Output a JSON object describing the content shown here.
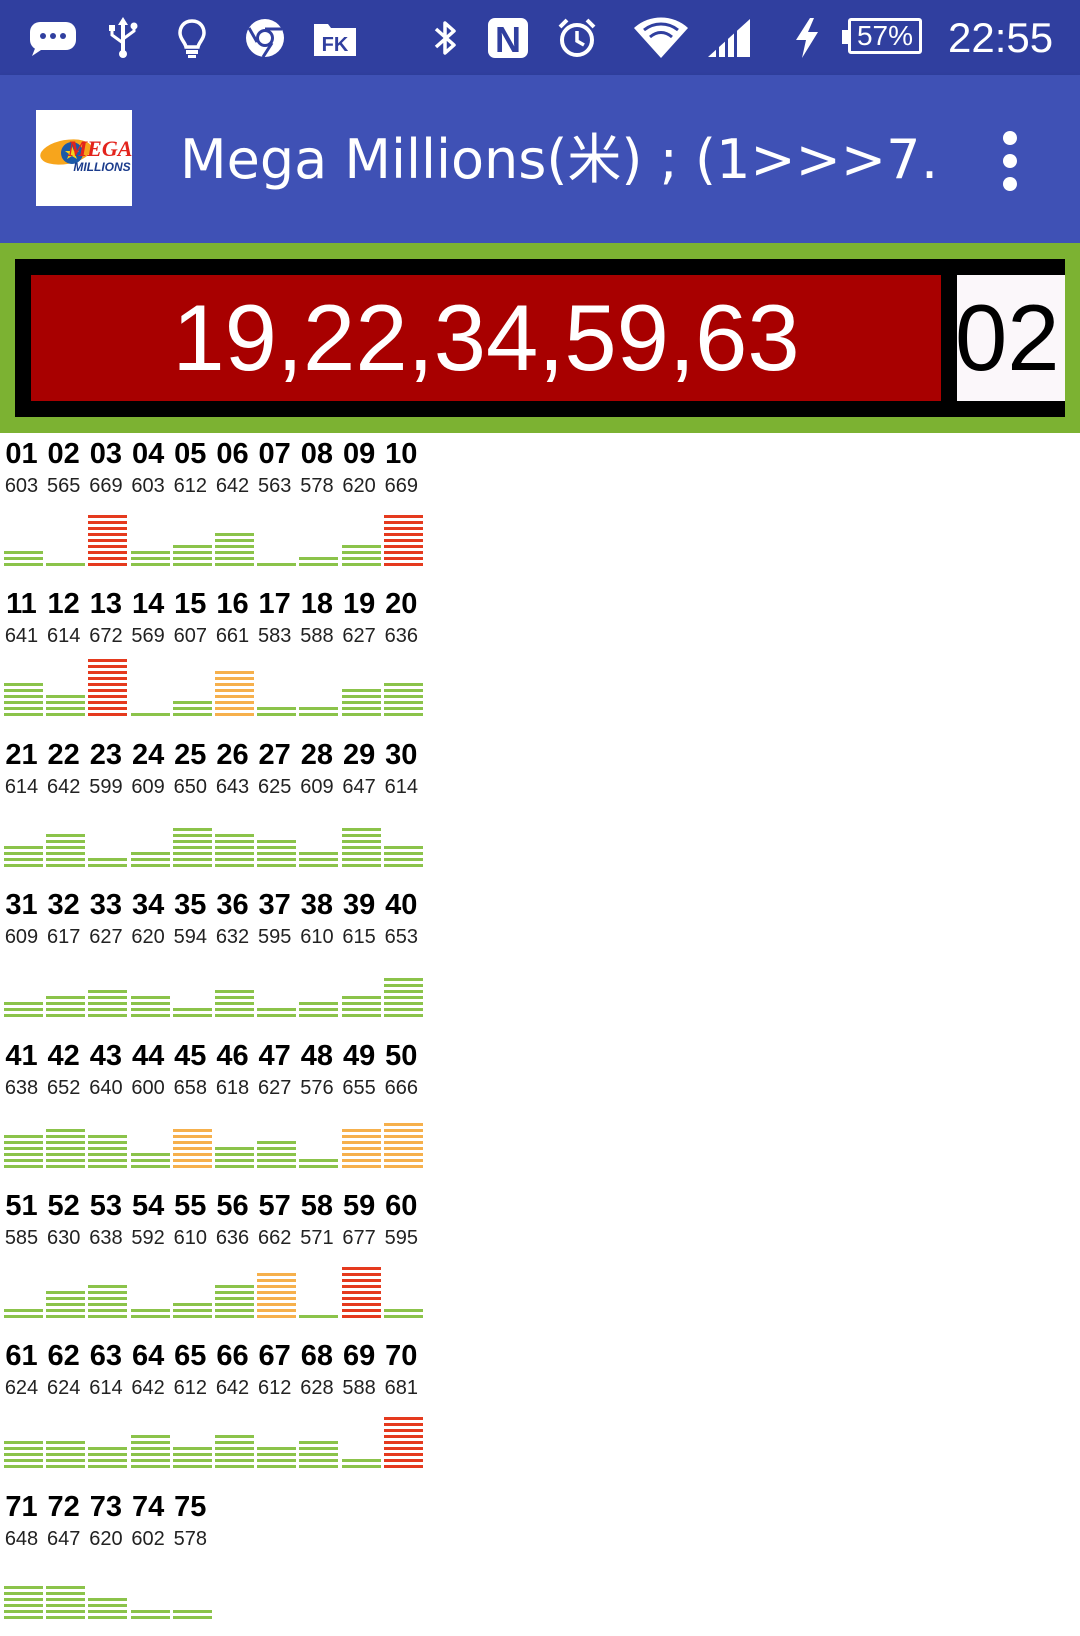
{
  "status_bar": {
    "icons": [
      "message-icon",
      "usb-icon",
      "bulb-icon",
      "chrome-icon",
      "app-icon",
      "bluetooth-icon",
      "nfc-icon",
      "alarm-icon",
      "wifi-icon",
      "signal-icon",
      "charging-icon"
    ],
    "fk_label": "FK",
    "nfc_label": "N",
    "battery": "57%",
    "time": "22:55"
  },
  "app_bar": {
    "logo_text_top": "MEGA",
    "logo_text_bottom": "MILLIONS",
    "title": "Mega Millions(米) ; (1>>>7…",
    "menu_icon": "more-vert-icon"
  },
  "result": {
    "main_numbers": "19,22,34,59,63",
    "mega_ball": "02"
  },
  "colors": {
    "status_bar": "#303F9F",
    "app_bar": "#3F51B5",
    "banner": "#7CB232",
    "numbers_bg": "#A80000",
    "bar_green": "#8BC34A",
    "bar_orange": "#F6B04C",
    "bar_red": "#E53A1E"
  },
  "grid": [
    {
      "num": "01",
      "count": "603",
      "level": 2,
      "color": "green"
    },
    {
      "num": "02",
      "count": "565",
      "level": 0,
      "color": "green"
    },
    {
      "num": "03",
      "count": "669",
      "level": 8,
      "color": "red"
    },
    {
      "num": "04",
      "count": "603",
      "level": 2,
      "color": "green"
    },
    {
      "num": "05",
      "count": "612",
      "level": 3,
      "color": "green"
    },
    {
      "num": "06",
      "count": "642",
      "level": 5,
      "color": "green"
    },
    {
      "num": "07",
      "count": "563",
      "level": 0,
      "color": "green"
    },
    {
      "num": "08",
      "count": "578",
      "level": 1,
      "color": "green"
    },
    {
      "num": "09",
      "count": "620",
      "level": 3,
      "color": "green"
    },
    {
      "num": "10",
      "count": "669",
      "level": 8,
      "color": "red"
    },
    {
      "num": "11",
      "count": "641",
      "level": 5,
      "color": "green"
    },
    {
      "num": "12",
      "count": "614",
      "level": 3,
      "color": "green"
    },
    {
      "num": "13",
      "count": "672",
      "level": 9,
      "color": "red"
    },
    {
      "num": "14",
      "count": "569",
      "level": 0,
      "color": "green"
    },
    {
      "num": "15",
      "count": "607",
      "level": 2,
      "color": "green"
    },
    {
      "num": "16",
      "count": "661",
      "level": 7,
      "color": "orange"
    },
    {
      "num": "17",
      "count": "583",
      "level": 1,
      "color": "green"
    },
    {
      "num": "18",
      "count": "588",
      "level": 1,
      "color": "green"
    },
    {
      "num": "19",
      "count": "627",
      "level": 4,
      "color": "green"
    },
    {
      "num": "20",
      "count": "636",
      "level": 5,
      "color": "green"
    },
    {
      "num": "21",
      "count": "614",
      "level": 3,
      "color": "green"
    },
    {
      "num": "22",
      "count": "642",
      "level": 5,
      "color": "green"
    },
    {
      "num": "23",
      "count": "599",
      "level": 1,
      "color": "green"
    },
    {
      "num": "24",
      "count": "609",
      "level": 2,
      "color": "green"
    },
    {
      "num": "25",
      "count": "650",
      "level": 6,
      "color": "green"
    },
    {
      "num": "26",
      "count": "643",
      "level": 5,
      "color": "green"
    },
    {
      "num": "27",
      "count": "625",
      "level": 4,
      "color": "green"
    },
    {
      "num": "28",
      "count": "609",
      "level": 2,
      "color": "green"
    },
    {
      "num": "29",
      "count": "647",
      "level": 6,
      "color": "green"
    },
    {
      "num": "30",
      "count": "614",
      "level": 3,
      "color": "green"
    },
    {
      "num": "31",
      "count": "609",
      "level": 2,
      "color": "green"
    },
    {
      "num": "32",
      "count": "617",
      "level": 3,
      "color": "green"
    },
    {
      "num": "33",
      "count": "627",
      "level": 4,
      "color": "green"
    },
    {
      "num": "34",
      "count": "620",
      "level": 3,
      "color": "green"
    },
    {
      "num": "35",
      "count": "594",
      "level": 1,
      "color": "green"
    },
    {
      "num": "36",
      "count": "632",
      "level": 4,
      "color": "green"
    },
    {
      "num": "37",
      "count": "595",
      "level": 1,
      "color": "green"
    },
    {
      "num": "38",
      "count": "610",
      "level": 2,
      "color": "green"
    },
    {
      "num": "39",
      "count": "615",
      "level": 3,
      "color": "green"
    },
    {
      "num": "40",
      "count": "653",
      "level": 6,
      "color": "green"
    },
    {
      "num": "41",
      "count": "638",
      "level": 5,
      "color": "green"
    },
    {
      "num": "42",
      "count": "652",
      "level": 6,
      "color": "green"
    },
    {
      "num": "43",
      "count": "640",
      "level": 5,
      "color": "green"
    },
    {
      "num": "44",
      "count": "600",
      "level": 2,
      "color": "green"
    },
    {
      "num": "45",
      "count": "658",
      "level": 6,
      "color": "orange"
    },
    {
      "num": "46",
      "count": "618",
      "level": 3,
      "color": "green"
    },
    {
      "num": "47",
      "count": "627",
      "level": 4,
      "color": "green"
    },
    {
      "num": "48",
      "count": "576",
      "level": 1,
      "color": "green"
    },
    {
      "num": "49",
      "count": "655",
      "level": 6,
      "color": "orange"
    },
    {
      "num": "50",
      "count": "666",
      "level": 7,
      "color": "orange"
    },
    {
      "num": "51",
      "count": "585",
      "level": 1,
      "color": "green"
    },
    {
      "num": "52",
      "count": "630",
      "level": 4,
      "color": "green"
    },
    {
      "num": "53",
      "count": "638",
      "level": 5,
      "color": "green"
    },
    {
      "num": "54",
      "count": "592",
      "level": 1,
      "color": "green"
    },
    {
      "num": "55",
      "count": "610",
      "level": 2,
      "color": "green"
    },
    {
      "num": "56",
      "count": "636",
      "level": 5,
      "color": "green"
    },
    {
      "num": "57",
      "count": "662",
      "level": 7,
      "color": "orange"
    },
    {
      "num": "58",
      "count": "571",
      "level": 0,
      "color": "green"
    },
    {
      "num": "59",
      "count": "677",
      "level": 8,
      "color": "red"
    },
    {
      "num": "60",
      "count": "595",
      "level": 1,
      "color": "green"
    },
    {
      "num": "61",
      "count": "624",
      "level": 4,
      "color": "green"
    },
    {
      "num": "62",
      "count": "624",
      "level": 4,
      "color": "green"
    },
    {
      "num": "63",
      "count": "614",
      "level": 3,
      "color": "green"
    },
    {
      "num": "64",
      "count": "642",
      "level": 5,
      "color": "green"
    },
    {
      "num": "65",
      "count": "612",
      "level": 3,
      "color": "green"
    },
    {
      "num": "66",
      "count": "642",
      "level": 5,
      "color": "green"
    },
    {
      "num": "67",
      "count": "612",
      "level": 3,
      "color": "green"
    },
    {
      "num": "68",
      "count": "628",
      "level": 4,
      "color": "green"
    },
    {
      "num": "69",
      "count": "588",
      "level": 1,
      "color": "green"
    },
    {
      "num": "70",
      "count": "681",
      "level": 8,
      "color": "red"
    },
    {
      "num": "71",
      "count": "648",
      "level": 5,
      "color": "green"
    },
    {
      "num": "72",
      "count": "647",
      "level": 5,
      "color": "green"
    },
    {
      "num": "73",
      "count": "620",
      "level": 3,
      "color": "green"
    },
    {
      "num": "74",
      "count": "602",
      "level": 1,
      "color": "green"
    },
    {
      "num": "75",
      "count": "578",
      "level": 1,
      "color": "green"
    }
  ]
}
